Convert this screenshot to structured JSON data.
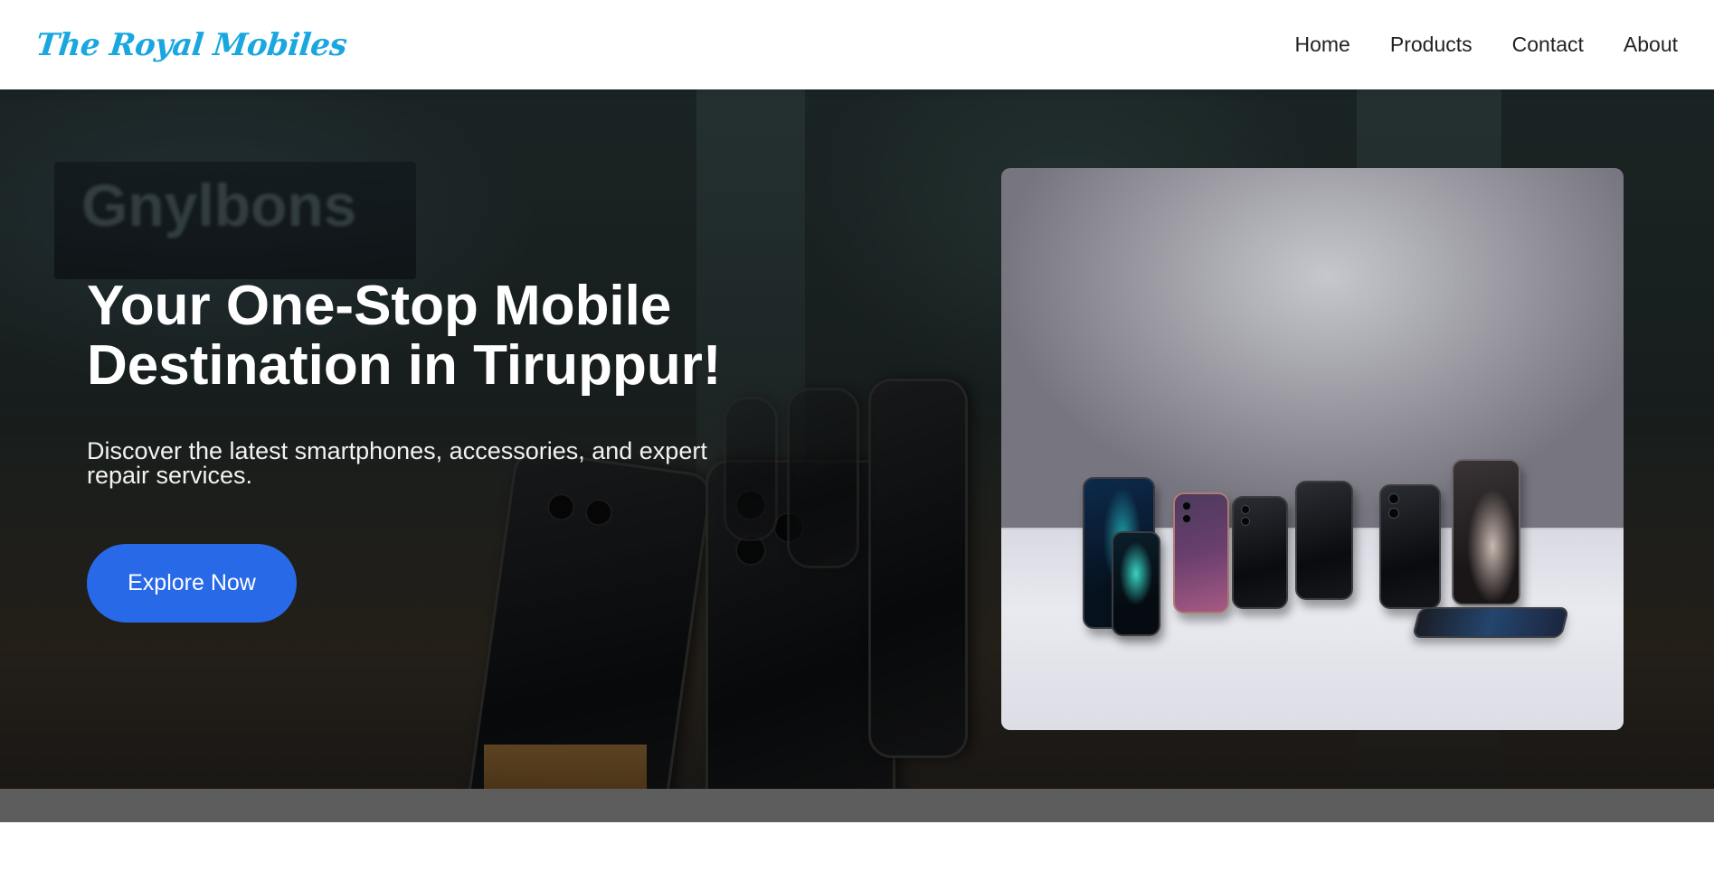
{
  "header": {
    "logo": "The Royal Mobiles",
    "nav": [
      "Home",
      "Products",
      "Contact",
      "About"
    ]
  },
  "hero": {
    "title_line1": "Your One-Stop Mobile",
    "title_line2": "Destination in Tiruppur!",
    "subtitle": "Discover the latest smartphones, accessories, and expert repair services.",
    "cta_label": "Explore Now",
    "background_sign_text": "Gnylbons"
  },
  "colors": {
    "logo": "#1aa7e0",
    "cta": "#2869e8",
    "header_bg": "#ffffff",
    "hero_text": "#ffffff"
  }
}
